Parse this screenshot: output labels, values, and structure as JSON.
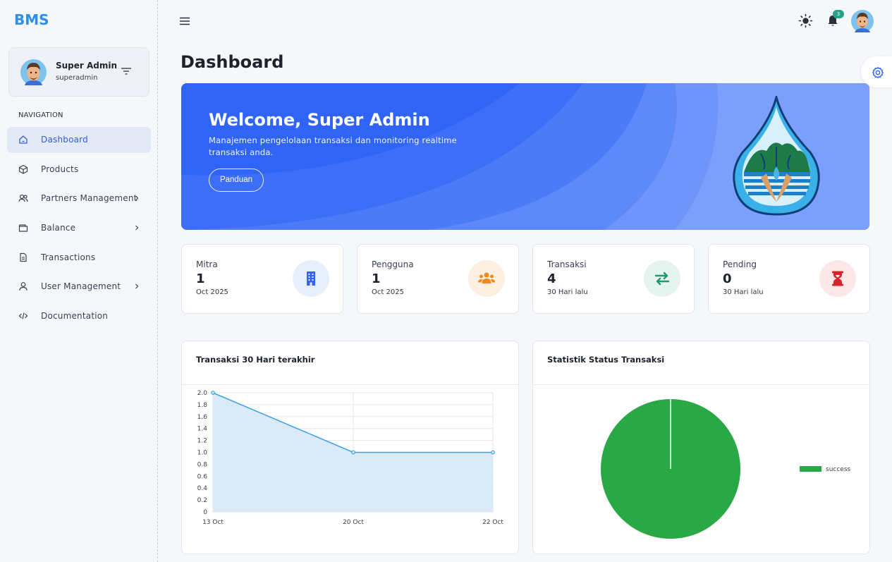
{
  "app": {
    "logo": "BMS"
  },
  "user": {
    "name": "Super Admin",
    "login": "superadmin"
  },
  "nav": {
    "heading": "NAVIGATION",
    "items": [
      {
        "label": "Dashboard",
        "icon": "home-icon",
        "active": true
      },
      {
        "label": "Products",
        "icon": "box-icon"
      },
      {
        "label": "Partners Management",
        "icon": "users-icon",
        "submenu": true
      },
      {
        "label": "Balance",
        "icon": "wallet-icon",
        "submenu": true
      },
      {
        "label": "Transactions",
        "icon": "document-icon"
      },
      {
        "label": "User Management",
        "icon": "user-icon",
        "submenu": true
      },
      {
        "label": "Documentation",
        "icon": "code-icon"
      }
    ]
  },
  "header": {
    "notification_count": "3"
  },
  "page": {
    "title": "Dashboard"
  },
  "banner": {
    "title": "Welcome, Super Admin",
    "subtitle": "Manajemen pengelolaan transaksi dan monitoring realtime transaksi anda.",
    "button_label": "Panduan"
  },
  "stats": [
    {
      "label": "Mitra",
      "value": "1",
      "sub": "Oct 2025",
      "icon": "building-icon",
      "color": "#2f64f6",
      "bg": "#e7eefc"
    },
    {
      "label": "Pengguna",
      "value": "1",
      "sub": "Oct 2025",
      "icon": "users-group-icon",
      "color": "#f08a1c",
      "bg": "#fdf0e3"
    },
    {
      "label": "Transaksi",
      "value": "4",
      "sub": "30 Hari lalu",
      "icon": "transfer-icon",
      "color": "#1f9a6f",
      "bg": "#e5f4ee"
    },
    {
      "label": "Pending",
      "value": "0",
      "sub": "30 Hari lalu",
      "icon": "hourglass-icon",
      "color": "#d8232a",
      "bg": "#fbe7e8"
    }
  ],
  "panels": {
    "line_title": "Transaksi 30 Hari terakhir",
    "pie_title": "Statistik Status Transaksi"
  },
  "chart_data": [
    {
      "type": "line",
      "title": "Transaksi 30 Hari terakhir",
      "x": [
        "13 Oct",
        "20 Oct",
        "22 Oct"
      ],
      "values": [
        2,
        1,
        1
      ],
      "ylim": [
        0,
        2
      ],
      "yticks": [
        "0",
        "0.2",
        "0.4",
        "0.6",
        "0.8",
        "1.0",
        "1.2",
        "1.4",
        "1.6",
        "1.8",
        "2.0"
      ],
      "grid": true,
      "color": "#3aa1e6",
      "fill": "#d6e8f7"
    },
    {
      "type": "pie",
      "title": "Statistik Status Transaksi",
      "labels": [
        "success"
      ],
      "values": [
        4
      ],
      "colors": [
        "#2aa845"
      ],
      "legend": "right"
    }
  ]
}
